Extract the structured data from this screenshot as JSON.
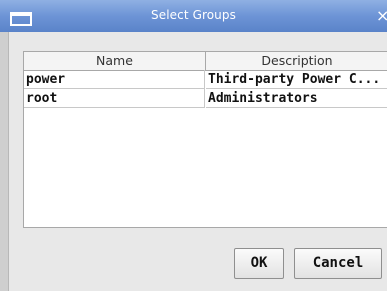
{
  "window": {
    "title": "Select Groups",
    "close_glyph": "×"
  },
  "table": {
    "columns": [
      "Name",
      "Description"
    ],
    "rows": [
      {
        "name": "power",
        "description": "Third-party Power C..."
      },
      {
        "name": "root",
        "description": "Administrators"
      }
    ]
  },
  "buttons": {
    "ok_label": "OK",
    "cancel_label": "Cancel"
  },
  "colors": {
    "titlebar": "#6d94d6",
    "dialog_background": "#e8e8e8"
  }
}
